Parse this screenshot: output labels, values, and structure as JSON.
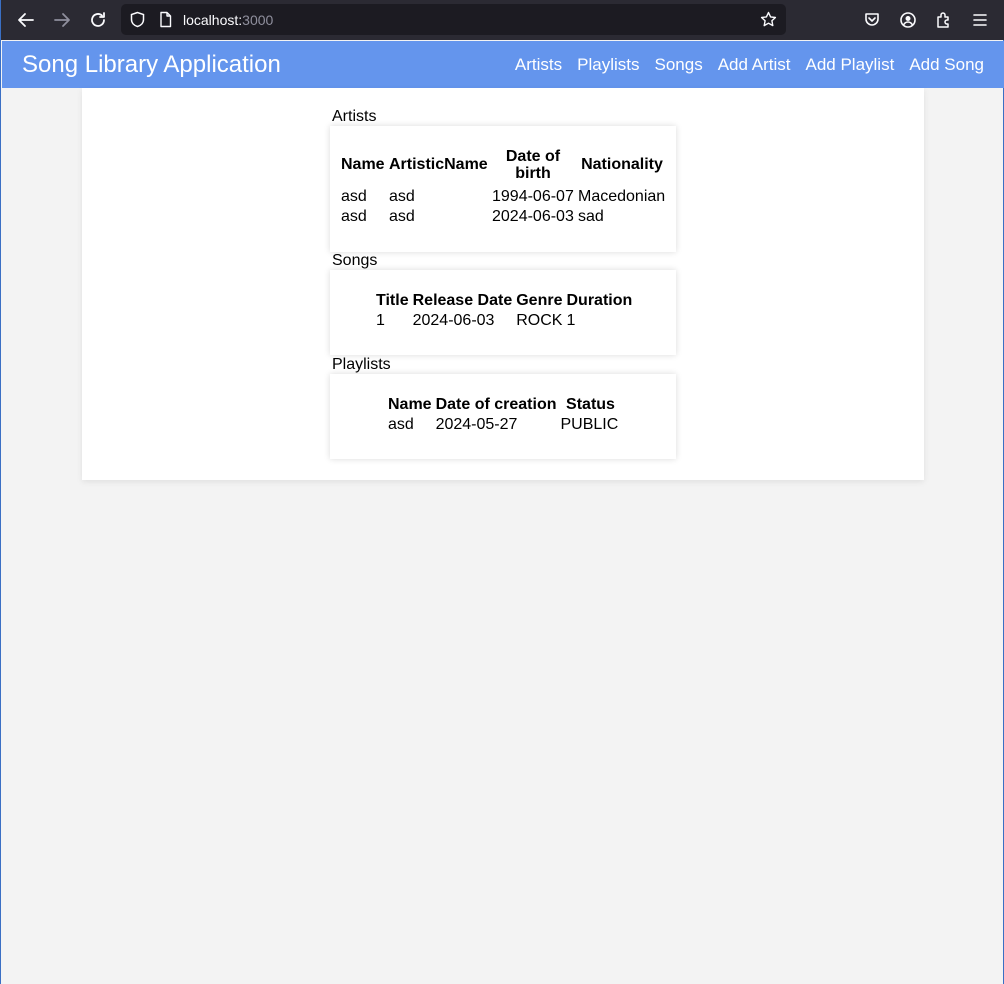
{
  "browser": {
    "url_host": "localhost:",
    "url_port": "3000"
  },
  "header": {
    "title": "Song Library Application",
    "nav": [
      "Artists",
      "Playlists",
      "Songs",
      "Add Artist",
      "Add Playlist",
      "Add Song"
    ],
    "color": "#6495ed"
  },
  "artists": {
    "label": "Artists",
    "columns": [
      "Name",
      "ArtisticName",
      "Date of birth",
      "Nationality"
    ],
    "rows": [
      [
        "asd",
        "asd",
        "1994-06-07",
        "Macedonian"
      ],
      [
        "asd",
        "asd",
        "2024-06-03",
        "sad"
      ]
    ]
  },
  "songs": {
    "label": "Songs",
    "columns": [
      "Title",
      "Release Date",
      "Genre",
      "Duration"
    ],
    "rows": [
      [
        "1",
        "2024-06-03",
        "ROCK",
        "1"
      ]
    ]
  },
  "playlists": {
    "label": "Playlists",
    "columns": [
      "Name",
      "Date of creation",
      "Status"
    ],
    "rows": [
      [
        "asd",
        "2024-05-27",
        "PUBLIC"
      ]
    ]
  }
}
